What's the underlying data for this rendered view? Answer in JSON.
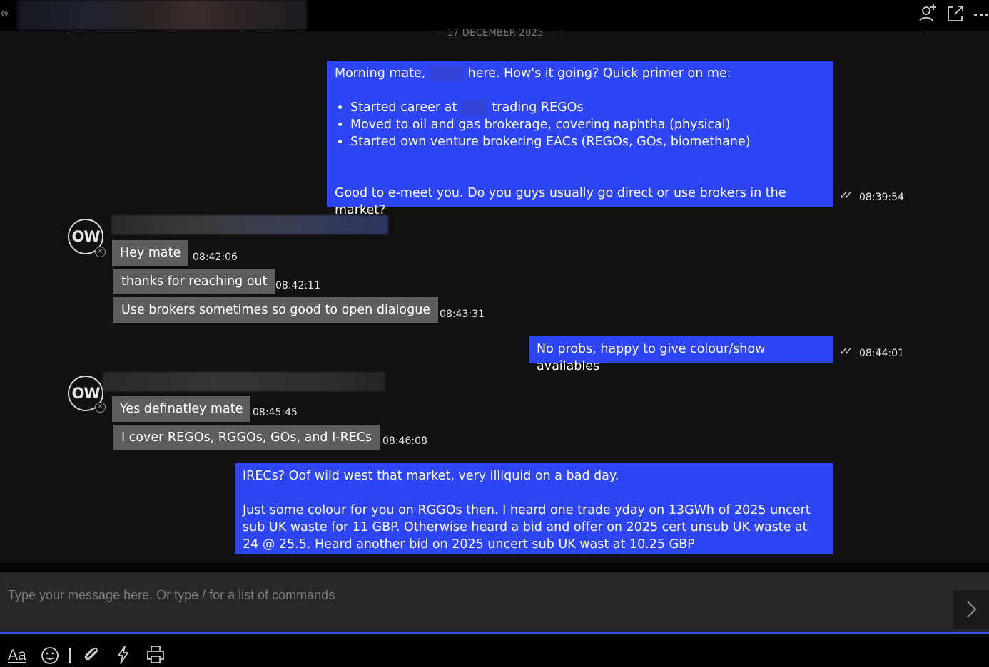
{
  "header": {
    "icons": [
      "add-user-icon",
      "pop-out-icon",
      "more-options-icon"
    ]
  },
  "date_separator": "17 DECEMBER 2025",
  "messages": {
    "m1": {
      "line1_before": "Morning mate,",
      "line1_after": "here. How's it going? Quick primer on me:",
      "bullet1_before": "Started career at",
      "bullet1_after": "trading REGOs",
      "bullet2": "Moved to oil and gas brokerage, covering naphtha (physical)",
      "bullet3": "Started own venture brokering EACs (REGOs, GOs, biomethane)",
      "closing": "Good to e-meet you. Do you guys usually go direct or use brokers in the market?",
      "time": "08:39:54"
    },
    "m2": {
      "avatar": "OW",
      "text": "Hey mate",
      "time": "08:42:06"
    },
    "m3": {
      "text": "thanks for reaching out",
      "time": "08:42:11"
    },
    "m4": {
      "text": "Use brokers sometimes so good to open dialogue",
      "time": "08:43:31"
    },
    "m5": {
      "text": "No probs, happy to give colour/show availables",
      "time": "08:44:01"
    },
    "m6": {
      "avatar": "OW",
      "text": "Yes definatley mate",
      "time": "08:45:45"
    },
    "m7": {
      "text": "I cover REGOs, RGGOs, GOs, and I-RECs",
      "time": "08:46:08"
    },
    "m8": {
      "line1": "IRECs? Oof wild west that market, very illiquid on a bad day.",
      "para2": "Just some colour for you on RGGOs then. I heard one trade yday on 13GWh of 2025 uncert sub UK waste for 11 GBP. Otherwise heard a bid and offer on 2025 cert unsub UK waste at 24 @ 25.5. Heard another bid on 2025 uncert sub UK wast at 10.25 GBP"
    }
  },
  "composer": {
    "placeholder": "Type your message here. Or type / for a list of commands",
    "value": ""
  },
  "toolbar": {
    "format_label": "Aa",
    "icons": [
      "emoji-icon",
      "attachment-icon",
      "lightning-icon",
      "print-icon"
    ]
  },
  "colors": {
    "outgoing_bubble": "#2e45f5",
    "incoming_bubble": "#5d5d5d",
    "background": "#111111",
    "accent_line": "#3a4df5"
  }
}
